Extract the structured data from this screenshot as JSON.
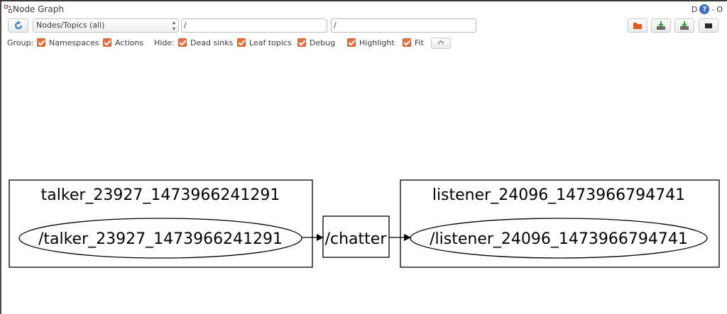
{
  "window": {
    "title": "Node Graph",
    "controls_label": "D",
    "help_glyph": "?",
    "close_glyph": "O"
  },
  "toolbar": {
    "view_mode": "Nodes/Topics (all)",
    "node_filter": "/",
    "topic_filter": "/"
  },
  "options": {
    "group_label": "Group:",
    "hide_label": "Hide:",
    "namespaces": "Namespaces",
    "actions": "Actions",
    "dead_sinks": "Dead sinks",
    "leaf_topics": "Leaf topics",
    "debug": "Debug",
    "highlight": "Highlight",
    "fit": "Fit"
  },
  "graph": {
    "talker_group": "talker_23927_1473966241291",
    "talker_node": "/talker_23927_1473966241291",
    "topic": "/chatter",
    "listener_group": "listener_24096_1473966794741",
    "listener_node": "/listener_24096_1473966794741"
  },
  "colors": {
    "checkbox": "#e6713e",
    "help": "#3d6fc4"
  }
}
